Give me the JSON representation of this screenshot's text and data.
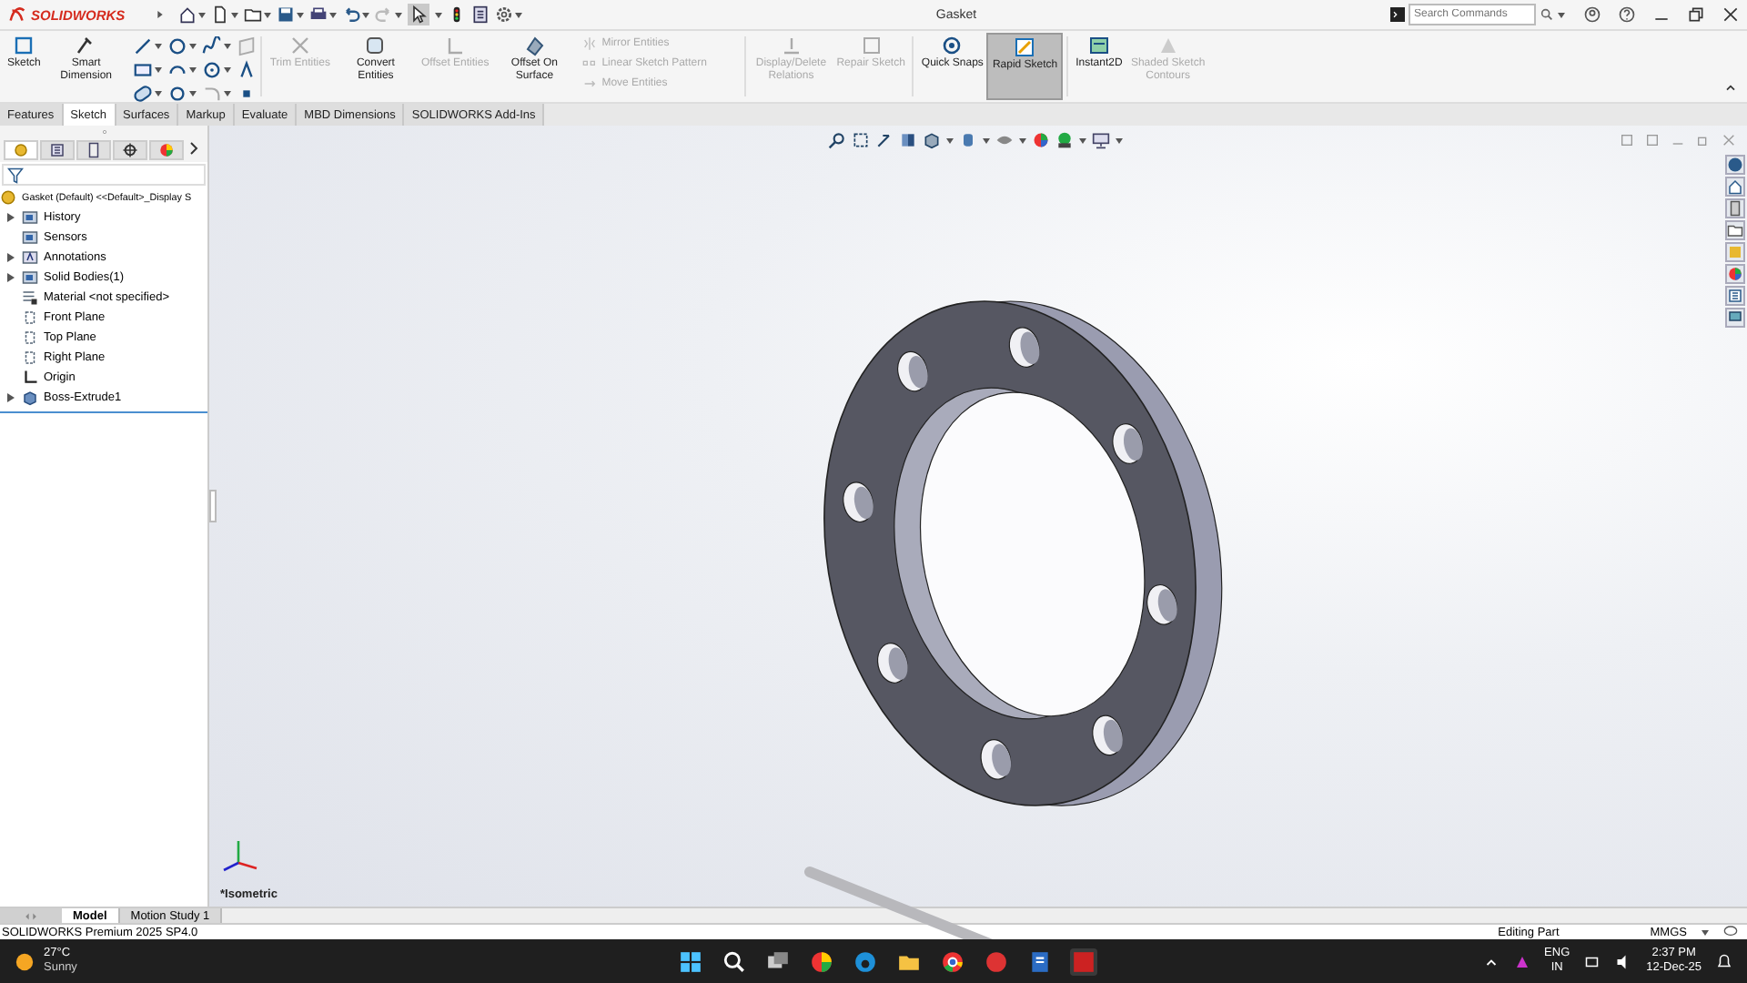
{
  "app": {
    "logo": "SOLIDWORKS",
    "title": "Gasket"
  },
  "search": {
    "placeholder": "Search Commands"
  },
  "ribbon": [
    {
      "label": "Sketch",
      "disabled": false,
      "selected": false
    },
    {
      "label": "Smart Dimension",
      "disabled": false,
      "selected": false
    },
    {
      "kind": "grid"
    },
    {
      "label": "Trim Entities",
      "disabled": true,
      "selected": false
    },
    {
      "label": "Convert Entities",
      "disabled": false,
      "selected": false
    },
    {
      "label": "Offset Entities",
      "disabled": true,
      "selected": false
    },
    {
      "label": "Offset On Surface",
      "disabled": false,
      "selected": false
    },
    {
      "kind": "list",
      "items": [
        {
          "label": "Mirror Entities",
          "disabled": true
        },
        {
          "label": "Linear Sketch Pattern",
          "disabled": true
        },
        {
          "label": "Move Entities",
          "disabled": true
        }
      ]
    },
    {
      "label": "Display/Delete Relations",
      "disabled": true,
      "selected": false
    },
    {
      "label": "Repair Sketch",
      "disabled": true,
      "selected": false
    },
    {
      "label": "Quick Snaps",
      "disabled": false,
      "selected": false
    },
    {
      "label": "Rapid Sketch",
      "disabled": false,
      "selected": true
    },
    {
      "label": "Instant2D",
      "disabled": false,
      "selected": false
    },
    {
      "label": "Shaded Sketch Contours",
      "disabled": true,
      "selected": false
    }
  ],
  "tabs": [
    {
      "label": "Features",
      "selected": false
    },
    {
      "label": "Sketch",
      "selected": true
    },
    {
      "label": "Surfaces",
      "selected": false
    },
    {
      "label": "Markup",
      "selected": false
    },
    {
      "label": "Evaluate",
      "selected": false
    },
    {
      "label": "MBD Dimensions",
      "selected": false
    },
    {
      "label": "SOLIDWORKS Add-Ins",
      "selected": false
    }
  ],
  "panel_tabs": [
    {
      "selected": true
    },
    {
      "selected": false
    },
    {
      "selected": false
    },
    {
      "selected": false
    },
    {
      "selected": false
    }
  ],
  "tree": {
    "root": "Gasket (Default) <<Default>_Display S",
    "items": [
      {
        "label": "History",
        "collapsible": true
      },
      {
        "label": "Sensors",
        "collapsible": false
      },
      {
        "label": "Annotations",
        "collapsible": true
      },
      {
        "label": "Solid Bodies(1)",
        "collapsible": true
      },
      {
        "label": "Material <not specified>",
        "collapsible": false
      },
      {
        "label": "Front Plane",
        "collapsible": false
      },
      {
        "label": "Top Plane",
        "collapsible": false
      },
      {
        "label": "Right Plane",
        "collapsible": false
      },
      {
        "label": "Origin",
        "collapsible": false
      },
      {
        "label": "Boss-Extrude1",
        "collapsible": true
      }
    ]
  },
  "viewport": {
    "view_label": "*Isometric"
  },
  "bottom_tabs": [
    {
      "label": "Model",
      "selected": true
    },
    {
      "label": "Motion Study 1",
      "selected": false
    }
  ],
  "status_bar": {
    "product": "SOLIDWORKS Premium 2025 SP4.0",
    "mode": "Editing Part",
    "units": "MMGS"
  },
  "taskbar": {
    "temperature": "27°C",
    "weather": "Sunny",
    "language": "ENG",
    "region": "IN",
    "time": "2:37 PM",
    "date": "12-Dec-25"
  }
}
